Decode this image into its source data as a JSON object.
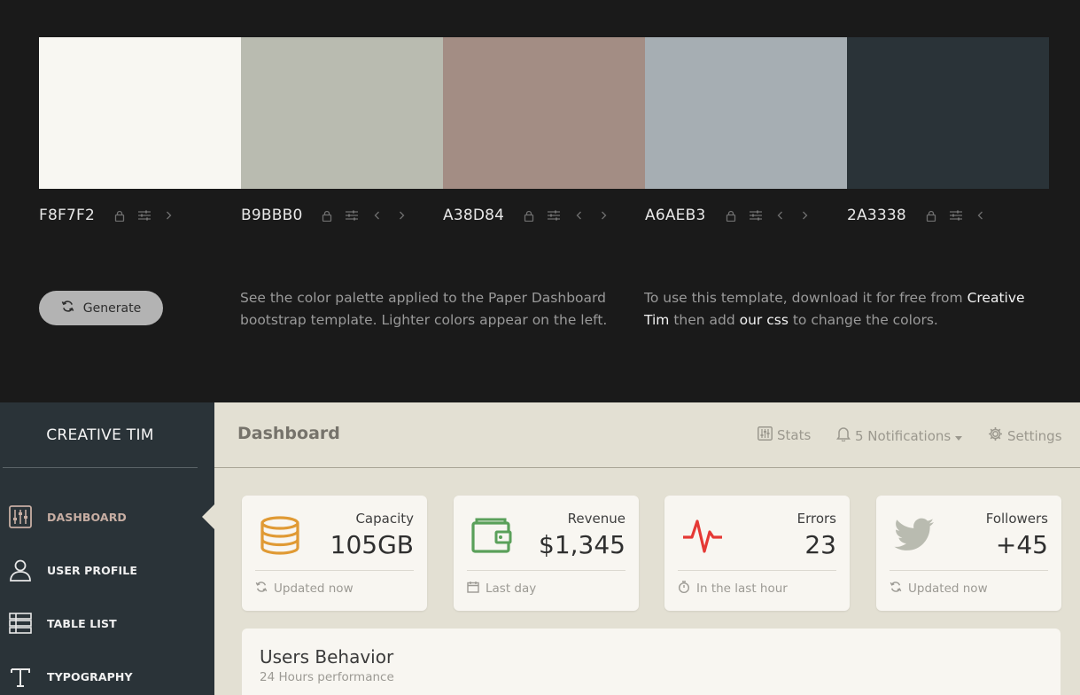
{
  "palette": {
    "swatches": [
      {
        "hex": "F8F7F2",
        "color": "#F8F7F2",
        "icons": [
          "lock-icon",
          "sliders-icon",
          "chevron-right-icon"
        ]
      },
      {
        "hex": "B9BBB0",
        "color": "#B9BBB0",
        "icons": [
          "lock-icon",
          "sliders-icon",
          "chevron-left-icon",
          "chevron-right-icon"
        ]
      },
      {
        "hex": "A38D84",
        "color": "#A38D84",
        "icons": [
          "lock-icon",
          "sliders-icon",
          "chevron-left-icon",
          "chevron-right-icon"
        ]
      },
      {
        "hex": "A6AEB3",
        "color": "#A6AEB3",
        "icons": [
          "lock-icon",
          "sliders-icon",
          "chevron-left-icon",
          "chevron-right-icon"
        ]
      },
      {
        "hex": "2A3338",
        "color": "#2A3338",
        "icons": [
          "lock-icon",
          "sliders-icon",
          "chevron-left-icon"
        ]
      }
    ],
    "generate_label": "Generate",
    "description_left": "See the color palette applied to the Paper Dashboard bootstrap template. Lighter colors appear on the left.",
    "description_right": {
      "part1": "To use this template, download it for free from ",
      "link1": "Creative Tim",
      "part2": " then add ",
      "link2": "our css",
      "part3": " to change the colors."
    }
  },
  "dashboard": {
    "brand": "CREATIVE TIM",
    "sidebar": {
      "items": [
        {
          "label": "DASHBOARD",
          "icon": "dashboard-icon",
          "active": true
        },
        {
          "label": "USER PROFILE",
          "icon": "user-icon",
          "active": false
        },
        {
          "label": "TABLE LIST",
          "icon": "table-icon",
          "active": false
        },
        {
          "label": "TYPOGRAPHY",
          "icon": "typography-icon",
          "active": false
        }
      ]
    },
    "header": {
      "title": "Dashboard",
      "stats_label": "Stats",
      "notifications_label": "5 Notifications",
      "settings_label": "Settings"
    },
    "cards": [
      {
        "label": "Capacity",
        "value": "105GB",
        "footer": "Updated now",
        "icon": "database-icon",
        "footer_icon": "refresh-icon",
        "icon_color": "#e09a34"
      },
      {
        "label": "Revenue",
        "value": "$1,345",
        "footer": "Last day",
        "icon": "wallet-icon",
        "footer_icon": "calendar-icon",
        "icon_color": "#5aa05a"
      },
      {
        "label": "Errors",
        "value": "23",
        "footer": "In the last hour",
        "icon": "pulse-icon",
        "footer_icon": "timer-icon",
        "icon_color": "#e53935"
      },
      {
        "label": "Followers",
        "value": "+45",
        "footer": "Updated now",
        "icon": "twitter-icon",
        "footer_icon": "refresh-icon",
        "icon_color": "#b9bbb0"
      }
    ],
    "panel": {
      "title": "Users Behavior",
      "subtitle": "24 Hours performance"
    }
  }
}
